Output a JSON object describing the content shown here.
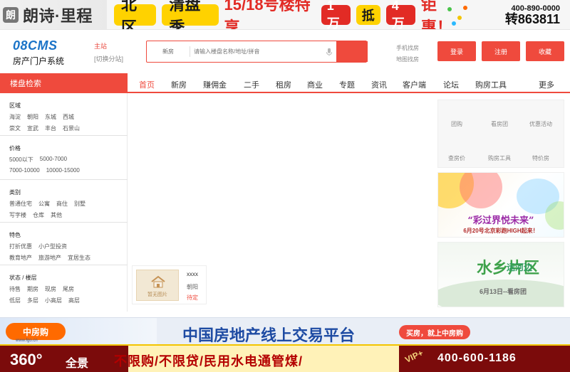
{
  "top_banner": {
    "brand": "朗诗·里程",
    "headline_1": "北区",
    "headline_2": "清盘季",
    "headline_3": "15/18号楼特享",
    "headline_4": "1万",
    "headline_5": "抵",
    "headline_6": "4万",
    "headline_7": "钜惠！",
    "hotline": "400-890-0000",
    "extension": "转863811"
  },
  "header": {
    "logo_title": "08CMS",
    "logo_sub": "房产门户系统",
    "city_current": "主站",
    "city_switch": "[切换分站]",
    "search": {
      "type": "新房",
      "placeholder": "请输入楼盘名称/地址/拼音"
    },
    "mobile_links": [
      "手机找房",
      "地图找房"
    ],
    "buttons": {
      "login": "登录",
      "register": "注册",
      "favorite": "收藏"
    }
  },
  "nav": {
    "left_title": "楼盘检索",
    "items": [
      "首页",
      "新房",
      "赚佣金",
      "二手",
      "租房",
      "商业",
      "专题",
      "资讯",
      "客户端",
      "论坛",
      "购房工具"
    ],
    "more": "更多"
  },
  "filters": {
    "area": {
      "title": "区域",
      "row1": [
        "海淀",
        "朝阳",
        "东城",
        "西城"
      ],
      "row2": [
        "崇文",
        "宣武",
        "丰台",
        "石景山"
      ]
    },
    "price": {
      "title": "价格",
      "row1": [
        "5000以下",
        "5000-7000"
      ],
      "row2": [
        "7000-10000",
        "10000-15000"
      ]
    },
    "category": {
      "title": "类别",
      "row1": [
        "普通住宅",
        "公寓",
        "商住",
        "别墅"
      ],
      "row2": [
        "写字楼",
        "仓库",
        "其他"
      ]
    },
    "feature": {
      "title": "特色",
      "row1": [
        "打折优惠",
        "小户型投资"
      ],
      "row2": [
        "教育地产",
        "旅游地产",
        "宜居生态"
      ]
    },
    "status": {
      "title": "状态 / 楼层",
      "row1": [
        "待售",
        "期房",
        "现房",
        "尾房"
      ],
      "row2": [
        "低层",
        "多层",
        "小高层",
        "高层"
      ]
    }
  },
  "quick_panel": {
    "row1": [
      "团购",
      "看房团",
      "优惠活动"
    ],
    "row2": [
      "查房价",
      "购房工具",
      "特价房"
    ]
  },
  "ads": {
    "ad1_title": "“彩过界悦未来”",
    "ad1_sub": "6月20号北京彩跑HIGH起来！",
    "ad2_main": "水乡片区",
    "ad2_sub": "运河边",
    "ad2_date": "6月13日--看房团"
  },
  "listing": {
    "thumb_caption": "暂无图片",
    "name": "xxxx",
    "area": "朝阳",
    "status": "待定"
  },
  "bottom_banner_1": {
    "logo": "中房购",
    "logo_url": "www.fgo.cn",
    "title": "中国房地产线上交易平台",
    "slogan": "买房，就上中房购"
  },
  "bottom_banner_2": {
    "left_360": "360°",
    "left_text": "全景",
    "middle": "不限购/不限贷/民用水电通管煤/",
    "vip": "VIP+",
    "phone": "400-600-1186"
  }
}
